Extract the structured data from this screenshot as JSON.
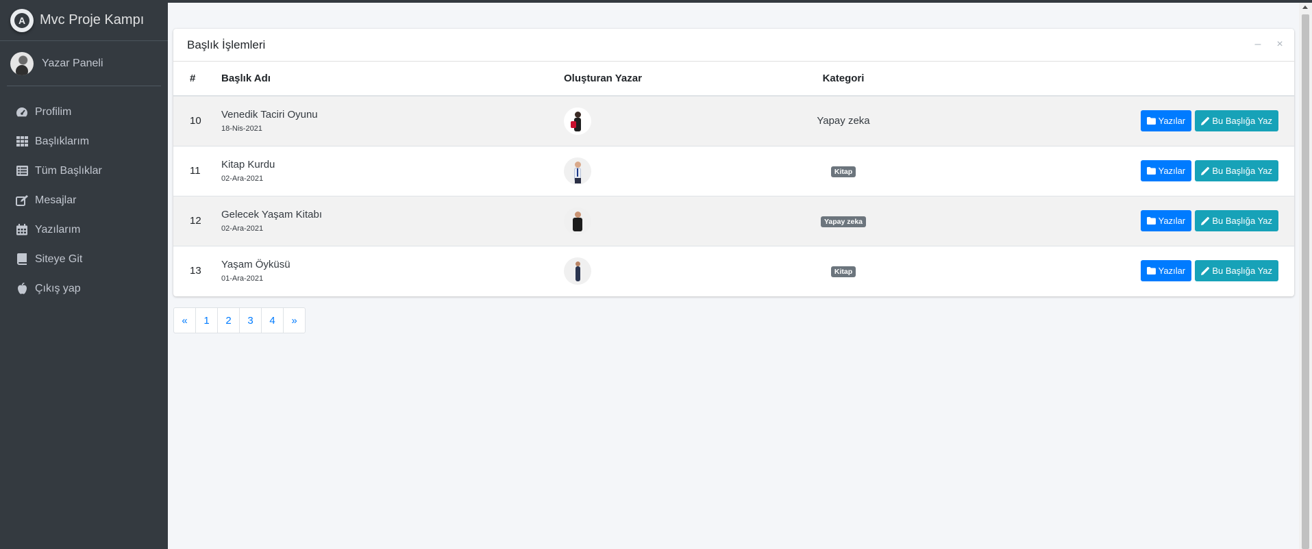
{
  "brand": {
    "title": "Mvc Proje Kampı",
    "logo_letter": "A"
  },
  "user": {
    "name": "Yazar Paneli"
  },
  "sidebar": {
    "items": [
      {
        "label": "Profilim",
        "icon": "tachometer-icon"
      },
      {
        "label": "Başlıklarım",
        "icon": "grid-icon"
      },
      {
        "label": "Tüm Başlıklar",
        "icon": "list-icon"
      },
      {
        "label": "Mesajlar",
        "icon": "edit-icon"
      },
      {
        "label": "Yazılarım",
        "icon": "calendar-icon"
      },
      {
        "label": "Siteye Git",
        "icon": "book-icon"
      },
      {
        "label": "Çıkış yap",
        "icon": "apple-icon"
      }
    ]
  },
  "card": {
    "title": "Başlık İşlemleri",
    "minimize_symbol": "–",
    "close_symbol": "×"
  },
  "table": {
    "headers": {
      "num": "#",
      "title": "Başlık Adı",
      "author": "Oluşturan Yazar",
      "category": "Kategori"
    },
    "rows": [
      {
        "id": "10",
        "title": "Venedik Taciri Oyunu",
        "date": "18-Nis-2021",
        "category": "Yapay zeka",
        "category_style": "text"
      },
      {
        "id": "11",
        "title": "Kitap Kurdu",
        "date": "02-Ara-2021",
        "category": "Kitap",
        "category_style": "badge"
      },
      {
        "id": "12",
        "title": "Gelecek Yaşam Kitabı",
        "date": "02-Ara-2021",
        "category": "Yapay zeka",
        "category_style": "badge"
      },
      {
        "id": "13",
        "title": "Yaşam Öyküsü",
        "date": "01-Ara-2021",
        "category": "Kitap",
        "category_style": "badge"
      }
    ],
    "button_posts": "Yazılar",
    "button_write": "Bu Başlığa Yaz"
  },
  "pagination": {
    "prev": "«",
    "pages": [
      "1",
      "2",
      "3",
      "4"
    ],
    "next": "»"
  },
  "colors": {
    "sidebar": "#343a40",
    "primary": "#007bff",
    "info": "#17a2b8",
    "badge": "#6c757d"
  }
}
